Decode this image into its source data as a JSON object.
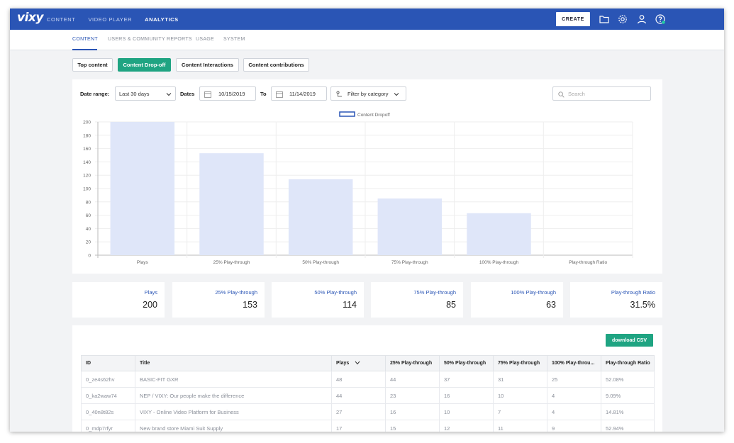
{
  "app": {
    "logo": "vixy",
    "nav": [
      "CONTENT",
      "VIDEO PLAYER",
      "ANALYTICS"
    ],
    "active_nav": "ANALYTICS",
    "create_label": "CREATE",
    "icons": [
      "folder-icon",
      "gear-icon",
      "user-icon",
      "help-icon"
    ]
  },
  "subnav": {
    "tabs": [
      "CONTENT",
      "USERS & COMMUNITY REPORTS",
      "USAGE",
      "SYSTEM"
    ],
    "active": "CONTENT"
  },
  "views": {
    "buttons": [
      "Top content",
      "Content Drop-off",
      "Content Interactions",
      "Content contributions"
    ],
    "active": "Content Drop-off"
  },
  "filters": {
    "date_range_label": "Date range:",
    "date_range_value": "Last 30 days",
    "dates_label": "Dates",
    "date_from": "10/15/2019",
    "to_label": "To",
    "date_to": "11/14/2019",
    "category_label": "Filter by category",
    "search_placeholder": "Search"
  },
  "chart_data": {
    "type": "bar",
    "categories": [
      "Plays",
      "25% Play-through",
      "50% Play-through",
      "75% Play-through",
      "100% Play-through",
      "Play-through Ratio"
    ],
    "series": [
      {
        "name": "Content Dropoff",
        "values": [
          200,
          153,
          114,
          85,
          63,
          0
        ]
      }
    ],
    "ylim": [
      0,
      200
    ],
    "yticks": [
      0,
      20,
      40,
      60,
      80,
      100,
      120,
      140,
      160,
      180,
      200
    ],
    "legend": "top-center",
    "grid": true,
    "bar_color": "#dfe6f9",
    "legend_color": "#2a55b5"
  },
  "stats": [
    {
      "label": "Plays",
      "value": "200"
    },
    {
      "label": "25% Play-through",
      "value": "153"
    },
    {
      "label": "50% Play-through",
      "value": "114"
    },
    {
      "label": "75% Play-through",
      "value": "85"
    },
    {
      "label": "100% Play-through",
      "value": "63"
    },
    {
      "label": "Play-through Ratio",
      "value": "31.5%"
    }
  ],
  "table": {
    "download_label": "download CSV",
    "columns": [
      "ID",
      "Title",
      "Plays",
      "25% Play-through",
      "50% Play-through",
      "75% Play-through",
      "100% Play-throu...",
      "Play-through Ratio"
    ],
    "rows": [
      [
        "0_ze4s62hv",
        "BASIC-FIT GXR",
        "48",
        "44",
        "37",
        "31",
        "25",
        "52.08%"
      ],
      [
        "0_ka2waw74",
        "NEP / VIXY: Our people make the difference",
        "44",
        "23",
        "16",
        "10",
        "4",
        "9.09%"
      ],
      [
        "0_40n8t82s",
        "VIXY - Online Video Platform for Business",
        "27",
        "16",
        "10",
        "7",
        "4",
        "14.81%"
      ],
      [
        "0_mdp7rfyr",
        "New brand store Miami Suit Supply",
        "17",
        "15",
        "12",
        "11",
        "9",
        "52.94%"
      ]
    ]
  },
  "colors": {
    "brand": "#2a55b5",
    "accent": "#1fa482"
  }
}
